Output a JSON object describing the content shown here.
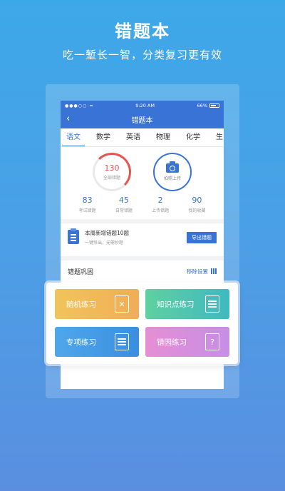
{
  "promo": {
    "title": "错题本",
    "subtitle": "吃一堑长一智，分类复习更有效"
  },
  "statusbar": {
    "signal": "●●●○○",
    "time": "9:20 AM",
    "battery": "66%"
  },
  "navbar": {
    "back_icon": "‹",
    "title": "错题本"
  },
  "tabs": [
    "语文",
    "数学",
    "英语",
    "物理",
    "化学",
    "生"
  ],
  "summary": {
    "total_count": "130",
    "total_label": "全部错题",
    "upload_label": "拍照上传"
  },
  "stats": [
    {
      "value": "83",
      "label": "考试错题"
    },
    {
      "value": "45",
      "label": "日常错题"
    },
    {
      "value": "2",
      "label": "上传错题"
    },
    {
      "value": "90",
      "label": "我的收藏"
    }
  ],
  "weekly": {
    "title": "本周新增错题10题",
    "subtitle": "一键导出，无需抄题",
    "export_label": "导出错题"
  },
  "consolidate": {
    "title": "错题巩固",
    "settings_label": "移除设置"
  },
  "practice": {
    "random": "随机练习",
    "knowledge": "知识点练习",
    "special": "专项练习",
    "review": "错因练习",
    "review_icon_glyph": "?"
  },
  "colors": {
    "primary": "#3a73d6",
    "accent_red": "#e9534f"
  }
}
